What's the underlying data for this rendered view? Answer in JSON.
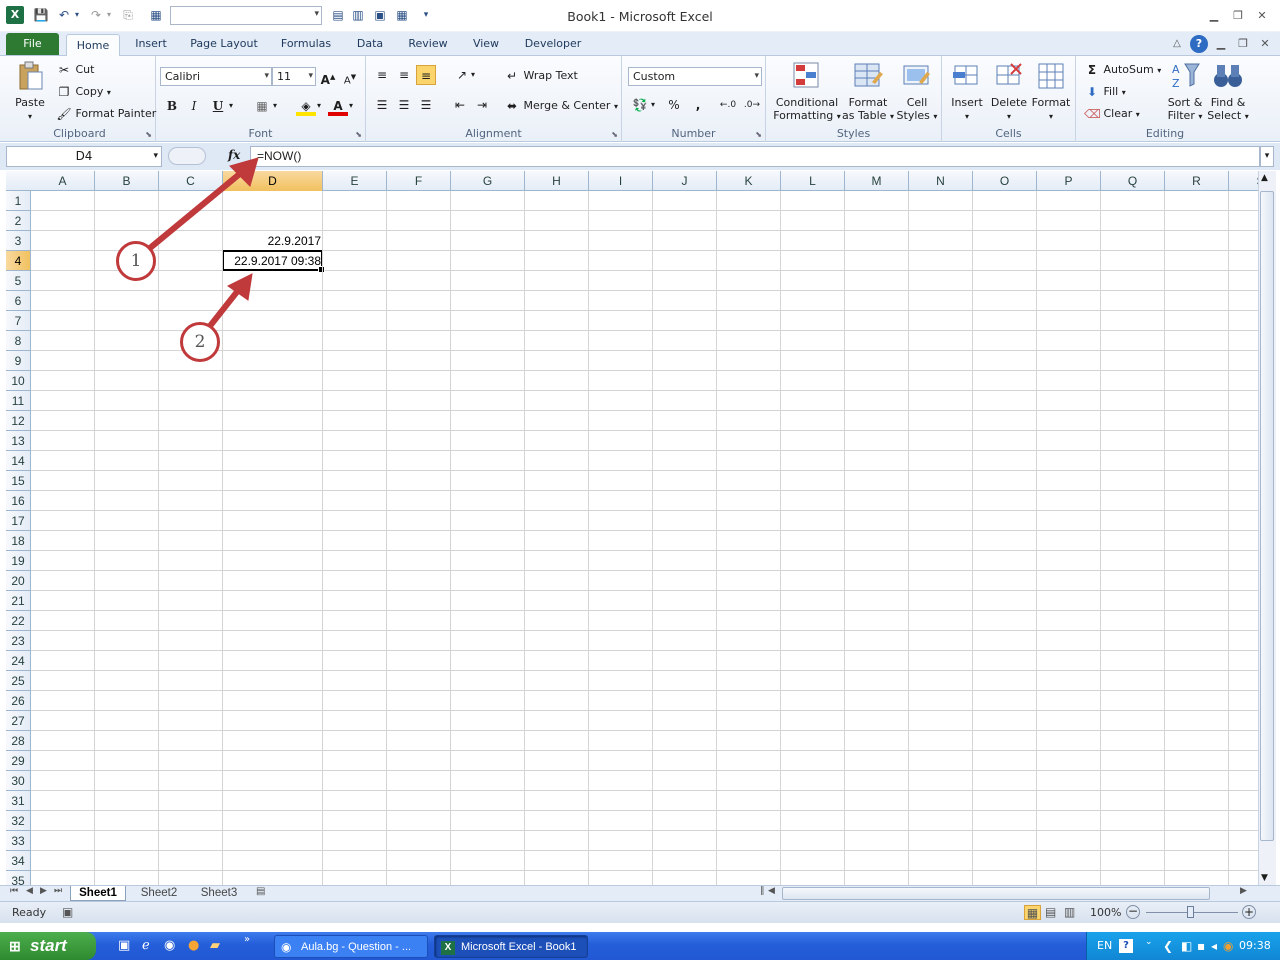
{
  "window": {
    "title": "Book1  -  Microsoft Excel"
  },
  "tabs": [
    "File",
    "Home",
    "Insert",
    "Page Layout",
    "Formulas",
    "Data",
    "Review",
    "View",
    "Developer"
  ],
  "ribbon": {
    "clipboard": {
      "label": "Clipboard",
      "paste": "Paste",
      "cut": "Cut",
      "copy": "Copy",
      "format_painter": "Format Painter"
    },
    "font": {
      "label": "Font",
      "name": "Calibri",
      "size": "11",
      "bold": "B",
      "italic": "I",
      "underline": "U"
    },
    "alignment": {
      "label": "Alignment",
      "wrap_text": "Wrap Text",
      "merge_center": "Merge & Center"
    },
    "number": {
      "label": "Number",
      "format": "Custom",
      "percent": "%",
      "comma": ","
    },
    "styles": {
      "label": "Styles",
      "conditional": "Conditional",
      "conditional2": "Formatting",
      "format_table": "Format",
      "format_table2": "as Table",
      "cell_styles": "Cell",
      "cell_styles2": "Styles"
    },
    "cells": {
      "label": "Cells",
      "insert": "Insert",
      "delete": "Delete",
      "format": "Format"
    },
    "editing": {
      "label": "Editing",
      "autosum": "AutoSum",
      "fill": "Fill",
      "clear": "Clear",
      "sort": "Sort &",
      "sort2": "Filter",
      "find": "Find &",
      "find2": "Select"
    }
  },
  "formula_bar": {
    "name_box": "D4",
    "fx": "fx",
    "formula": "=NOW()"
  },
  "grid": {
    "columns": [
      "A",
      "B",
      "C",
      "D",
      "E",
      "F",
      "G",
      "H",
      "I",
      "J",
      "K",
      "L",
      "M",
      "N",
      "O",
      "P",
      "Q",
      "R",
      "S"
    ],
    "rows": [
      "1",
      "2",
      "3",
      "4",
      "5",
      "6",
      "7",
      "8",
      "9",
      "10",
      "11",
      "12",
      "13",
      "14",
      "15",
      "16",
      "17",
      "18",
      "19",
      "20",
      "21",
      "22",
      "23",
      "24",
      "25",
      "26",
      "27",
      "28",
      "29",
      "30",
      "31",
      "32",
      "33",
      "34",
      "35"
    ],
    "selected_col": "D",
    "selected_row": "4",
    "cells": {
      "D3": "22.9.2017",
      "D4": "22.9.2017 09:38"
    }
  },
  "sheets": [
    "Sheet1",
    "Sheet2",
    "Sheet3"
  ],
  "status": {
    "ready": "Ready",
    "zoom": "100%"
  },
  "annotations": [
    "1",
    "2"
  ],
  "taskbar": {
    "start": "start",
    "task1": "Aula.bg - Question - ...",
    "task2": "Microsoft Excel - Book1",
    "lang": "EN",
    "clock": "09:38"
  }
}
